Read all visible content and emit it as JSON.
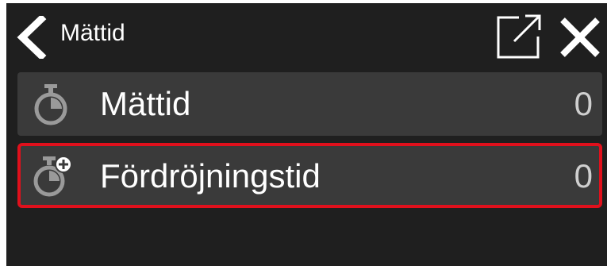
{
  "header": {
    "title": "Mättid",
    "back_icon": "chevron-left-icon",
    "open_external_icon": "open-external-icon",
    "close_icon": "close-icon"
  },
  "rows": [
    {
      "label": "Mättid",
      "value": "0",
      "icon": "stopwatch-icon",
      "selected": false
    },
    {
      "label": "Fördröjningstid",
      "value": "0",
      "icon": "stopwatch-plus-icon",
      "selected": true
    }
  ],
  "colors": {
    "background": "#1f1f1f",
    "row_background": "#3a3a3a",
    "selection_border": "#e0101c",
    "icon_gray": "#9a9a9a"
  }
}
